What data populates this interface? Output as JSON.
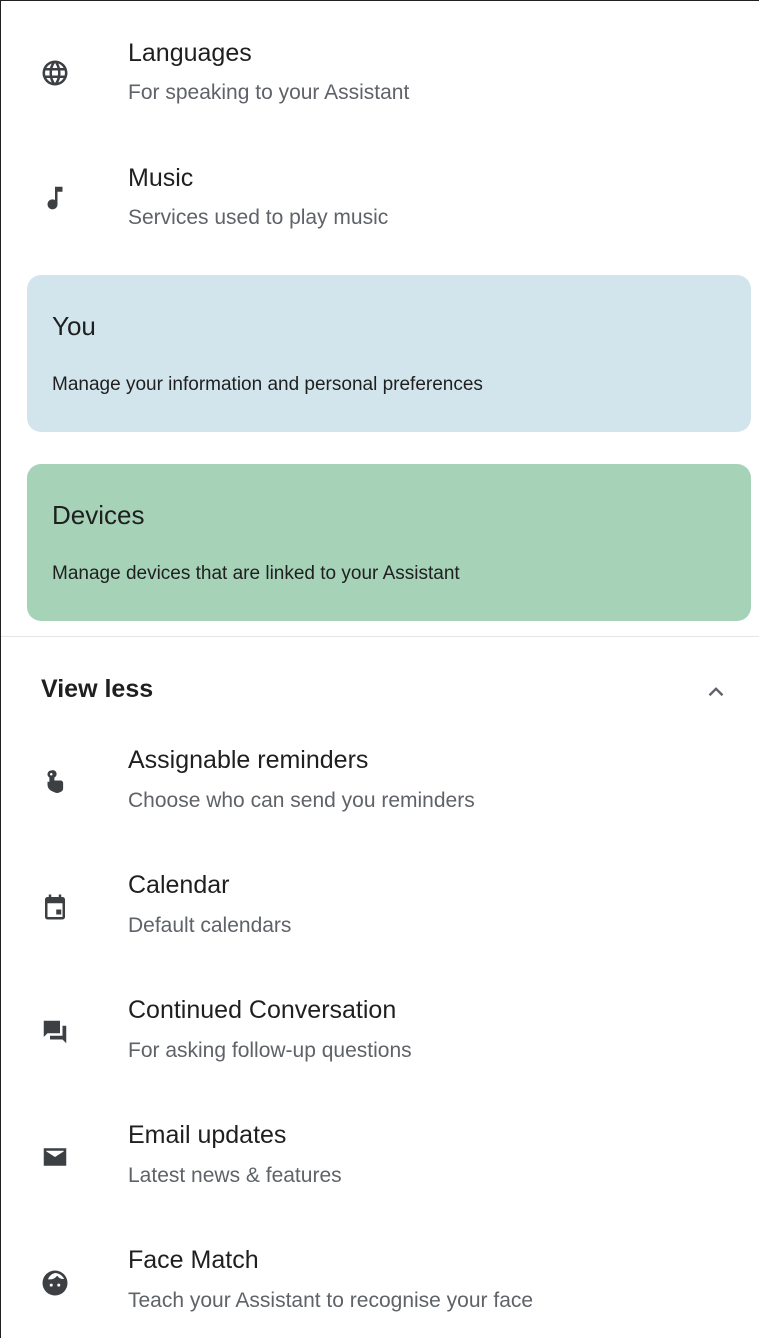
{
  "settings_top": [
    {
      "title": "Languages",
      "subtitle": "For speaking to your Assistant",
      "icon": "globe-icon"
    },
    {
      "title": "Music",
      "subtitle": "Services used to play music",
      "icon": "music-note-icon"
    }
  ],
  "cards": [
    {
      "title": "You",
      "description": "Manage your information and personal preferences",
      "color": "#d3e5ec"
    },
    {
      "title": "Devices",
      "description": "Manage devices that are linked to your Assistant",
      "color": "#a6d2b8"
    }
  ],
  "toggle": {
    "label": "View less",
    "icon": "chevron-up-icon"
  },
  "settings_more": [
    {
      "title": "Assignable reminders",
      "subtitle": "Choose who can send you reminders",
      "icon": "touch-reminder-icon"
    },
    {
      "title": "Calendar",
      "subtitle": "Default calendars",
      "icon": "calendar-icon"
    },
    {
      "title": "Continued Conversation",
      "subtitle": "For asking follow-up questions",
      "icon": "chat-bubbles-icon"
    },
    {
      "title": "Email updates",
      "subtitle": "Latest news & features",
      "icon": "email-icon"
    },
    {
      "title": "Face Match",
      "subtitle": "Teach your Assistant to recognise your face",
      "icon": "face-icon"
    }
  ]
}
